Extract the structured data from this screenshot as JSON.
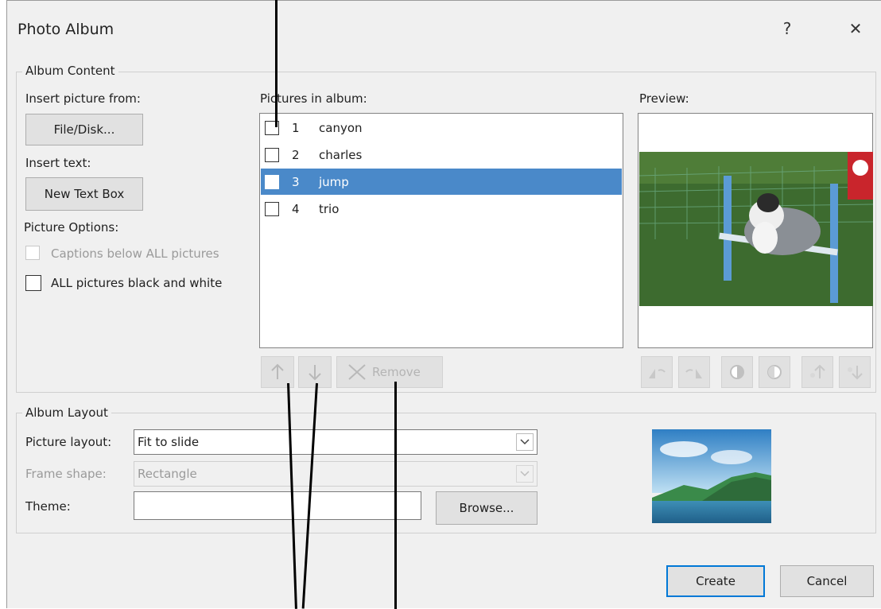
{
  "window": {
    "title": "Photo Album",
    "help": "?",
    "close": "✕"
  },
  "album_content": {
    "legend": "Album Content",
    "insert_picture_from": "Insert picture from:",
    "file_disk_button": "File/Disk...",
    "insert_text": "Insert text:",
    "new_text_box_button": "New Text Box",
    "picture_options": "Picture Options:",
    "captions_below": "Captions below ALL pictures",
    "black_and_white": "ALL pictures black and white",
    "pictures_in_album": "Pictures in album:",
    "pictures": [
      {
        "num": "1",
        "name": "canyon",
        "selected": false
      },
      {
        "num": "2",
        "name": "charles",
        "selected": false
      },
      {
        "num": "3",
        "name": "jump",
        "selected": true
      },
      {
        "num": "4",
        "name": "trio",
        "selected": false
      }
    ],
    "remove_button": "Remove",
    "preview": "Preview:"
  },
  "album_layout": {
    "legend": "Album Layout",
    "picture_layout_label": "Picture layout:",
    "picture_layout_value": "Fit to slide",
    "frame_shape_label": "Frame shape:",
    "frame_shape_value": "Rectangle",
    "theme_label": "Theme:",
    "theme_value": "",
    "browse_button": "Browse..."
  },
  "footer": {
    "create_button": "Create",
    "cancel_button": "Cancel"
  },
  "colors": {
    "selection": "#4a89c9",
    "dialog_bg": "#f0f0f0",
    "accent_border": "#0078d7"
  }
}
